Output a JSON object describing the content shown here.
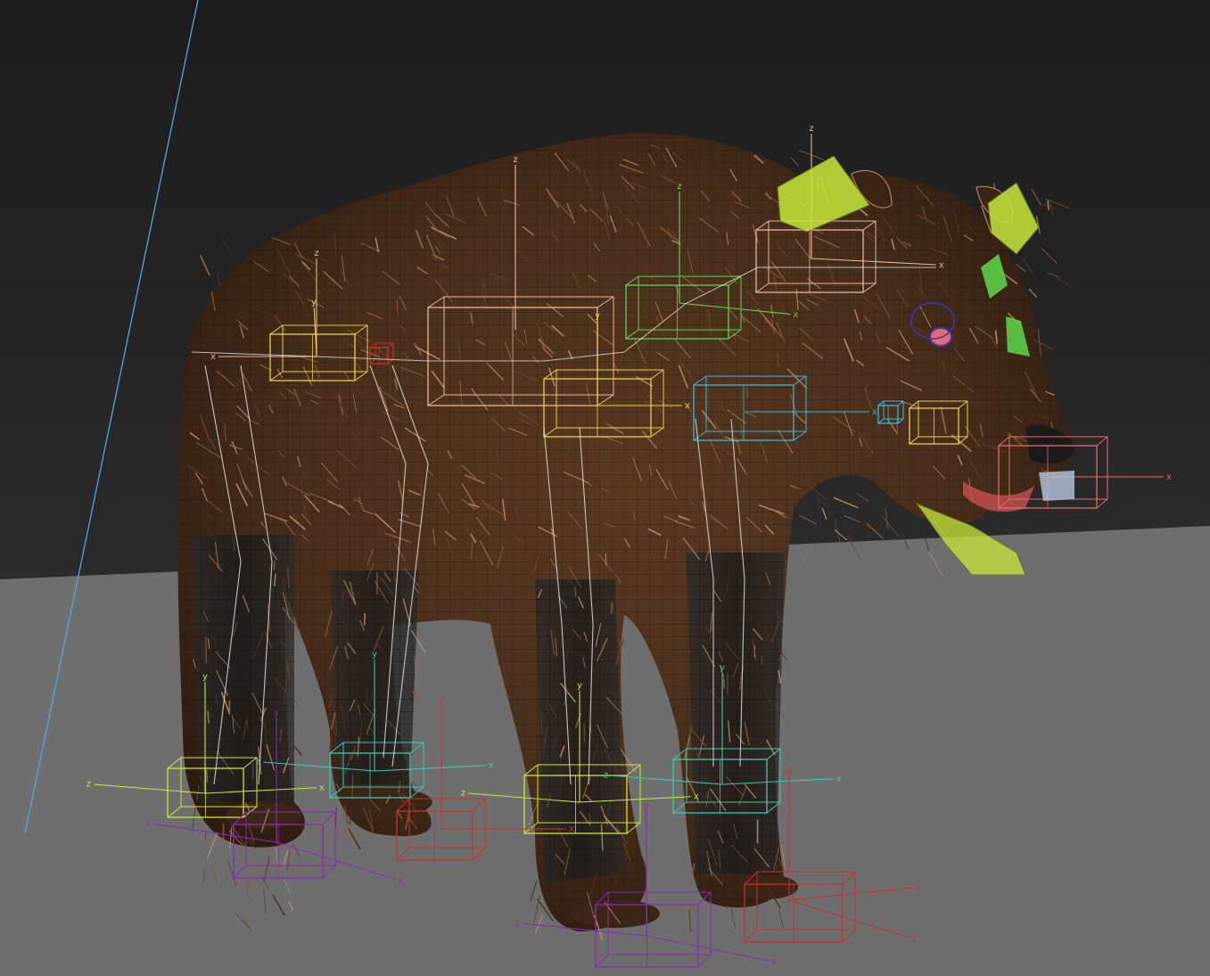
{
  "viewport": {
    "name": "3D perspective viewport",
    "background_top": "#1c1c1c",
    "background_bottom": "#353535",
    "ground_color": "#6e6e6e",
    "wire_color": "#111111"
  },
  "scene": {
    "model": "bear",
    "fur_colors": [
      "#4a2e1a",
      "#6b4226",
      "#8a5a36",
      "#a0704a",
      "#c49068"
    ]
  },
  "gizmo_colors": {
    "yellow": "#e8d24a",
    "peach": "#e8b89a",
    "cyan": "#3ab8d8",
    "teal": "#3cc8b4",
    "red": "#c83030",
    "purple": "#8a2ab8",
    "lime": "#c8e83a",
    "green": "#5ed84a",
    "pink": "#e86a6a",
    "blue": "#3a3ab8",
    "white": "#e0e0e0",
    "sky_line": "#4aa8e8"
  },
  "axis_labels": {
    "x": "x",
    "y": "y",
    "z": "z"
  }
}
